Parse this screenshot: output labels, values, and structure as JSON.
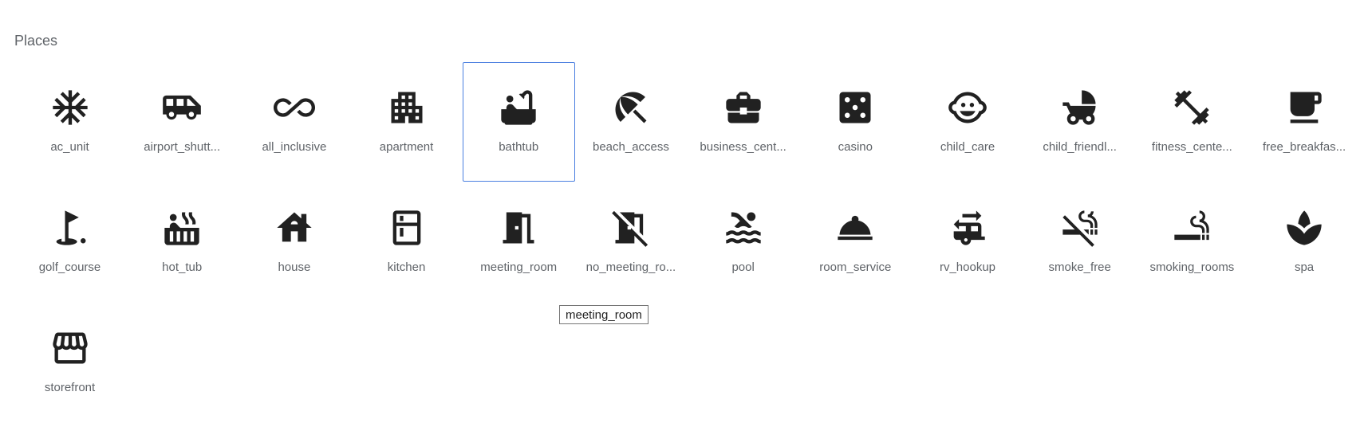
{
  "section": {
    "title": "Places"
  },
  "selected_index": 4,
  "icons": [
    {
      "name": "ac_unit",
      "label": "ac_unit",
      "icon": "ac-unit-icon"
    },
    {
      "name": "airport_shuttle",
      "label": "airport_shutt...",
      "icon": "airport-shuttle-icon"
    },
    {
      "name": "all_inclusive",
      "label": "all_inclusive",
      "icon": "all-inclusive-icon"
    },
    {
      "name": "apartment",
      "label": "apartment",
      "icon": "apartment-icon"
    },
    {
      "name": "bathtub",
      "label": "bathtub",
      "icon": "bathtub-icon"
    },
    {
      "name": "beach_access",
      "label": "beach_access",
      "icon": "beach-access-icon"
    },
    {
      "name": "business_center",
      "label": "business_cent...",
      "icon": "business-center-icon"
    },
    {
      "name": "casino",
      "label": "casino",
      "icon": "casino-icon"
    },
    {
      "name": "child_care",
      "label": "child_care",
      "icon": "child-care-icon"
    },
    {
      "name": "child_friendly",
      "label": "child_friendl...",
      "icon": "child-friendly-icon"
    },
    {
      "name": "fitness_center",
      "label": "fitness_cente...",
      "icon": "fitness-center-icon"
    },
    {
      "name": "free_breakfast",
      "label": "free_breakfas...",
      "icon": "free-breakfast-icon"
    },
    {
      "name": "golf_course",
      "label": "golf_course",
      "icon": "golf-course-icon"
    },
    {
      "name": "hot_tub",
      "label": "hot_tub",
      "icon": "hot-tub-icon"
    },
    {
      "name": "house",
      "label": "house",
      "icon": "house-icon"
    },
    {
      "name": "kitchen",
      "label": "kitchen",
      "icon": "kitchen-icon"
    },
    {
      "name": "meeting_room",
      "label": "meeting_room",
      "icon": "meeting-room-icon"
    },
    {
      "name": "no_meeting_room",
      "label": "no_meeting_ro...",
      "icon": "no-meeting-room-icon"
    },
    {
      "name": "pool",
      "label": "pool",
      "icon": "pool-icon"
    },
    {
      "name": "room_service",
      "label": "room_service",
      "icon": "room-service-icon"
    },
    {
      "name": "rv_hookup",
      "label": "rv_hookup",
      "icon": "rv-hookup-icon"
    },
    {
      "name": "smoke_free",
      "label": "smoke_free",
      "icon": "smoke-free-icon"
    },
    {
      "name": "smoking_rooms",
      "label": "smoking_rooms",
      "icon": "smoking-rooms-icon"
    },
    {
      "name": "spa",
      "label": "spa",
      "icon": "spa-icon"
    },
    {
      "name": "storefront",
      "label": "storefront",
      "icon": "storefront-icon"
    }
  ],
  "tooltip": {
    "text": "meeting_room"
  },
  "colors": {
    "icon": "#212121",
    "label": "#5f6368",
    "selection": "#4a7fe0"
  }
}
